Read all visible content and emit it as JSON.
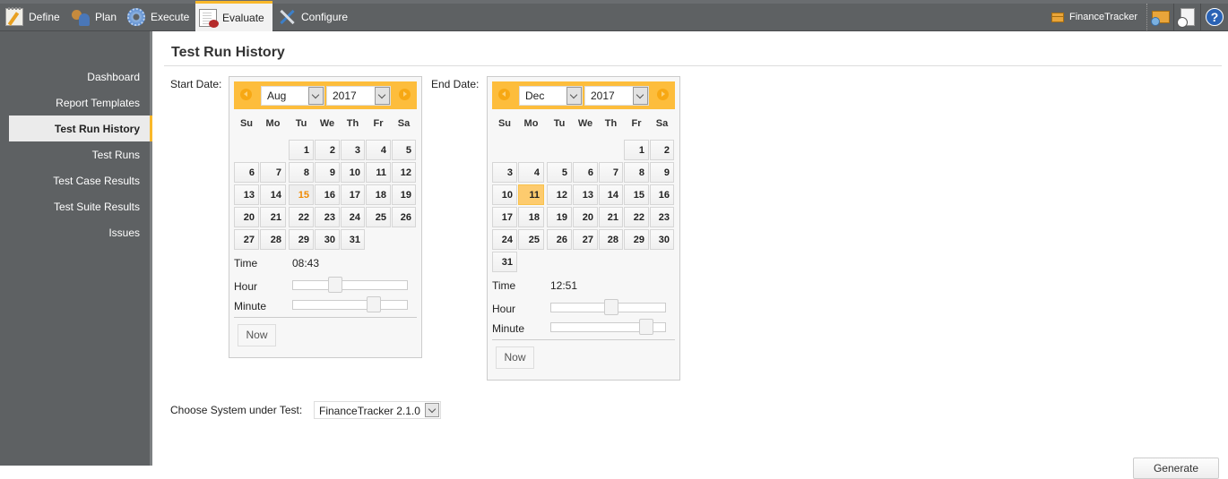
{
  "topnav": {
    "tabs": [
      {
        "label": "Define",
        "icon": "define-notepad-icon",
        "active": false
      },
      {
        "label": "Plan",
        "icon": "plan-people-icon",
        "active": false
      },
      {
        "label": "Execute",
        "icon": "execute-gear-icon",
        "active": false
      },
      {
        "label": "Evaluate",
        "icon": "evaluate-report-icon",
        "active": true
      },
      {
        "label": "Configure",
        "icon": "configure-tools-icon",
        "active": false
      }
    ],
    "project_name": "FinanceTracker",
    "tools": [
      "search-project-icon",
      "report-schedule-icon",
      "help-icon"
    ],
    "help_glyph": "?",
    "accent_color": "#f9b82a"
  },
  "sidebar": {
    "items": [
      {
        "label": "Dashboard",
        "active": false
      },
      {
        "label": "Report Templates",
        "active": false
      },
      {
        "label": "Test Run History",
        "active": true
      },
      {
        "label": "Test Runs",
        "active": false
      },
      {
        "label": "Test Case Results",
        "active": false
      },
      {
        "label": "Test Suite Results",
        "active": false
      },
      {
        "label": "Issues",
        "active": false
      }
    ]
  },
  "main": {
    "title": "Test Run History",
    "start_label": "Start Date:",
    "end_label": "End Date:",
    "weekdays": [
      "Su",
      "Mo",
      "Tu",
      "We",
      "Th",
      "Fr",
      "Sa"
    ],
    "start": {
      "month": "Aug",
      "year": "2017",
      "first_weekday": 2,
      "days_in_month": 31,
      "today": 15,
      "selected": null,
      "time_label": "Time",
      "time": "08:43",
      "hour_label": "Hour",
      "minute_label": "Minute",
      "hour": 8,
      "minute": 43,
      "now_label": "Now"
    },
    "end": {
      "month": "Dec",
      "year": "2017",
      "first_weekday": 5,
      "days_in_month": 31,
      "today": null,
      "selected": 11,
      "time_label": "Time",
      "time": "12:51",
      "hour_label": "Hour",
      "minute_label": "Minute",
      "hour": 12,
      "minute": 51,
      "now_label": "Now"
    },
    "sut_label": "Choose System under Test:",
    "sut_value": "FinanceTracker 2.1.0",
    "generate_label": "Generate"
  }
}
